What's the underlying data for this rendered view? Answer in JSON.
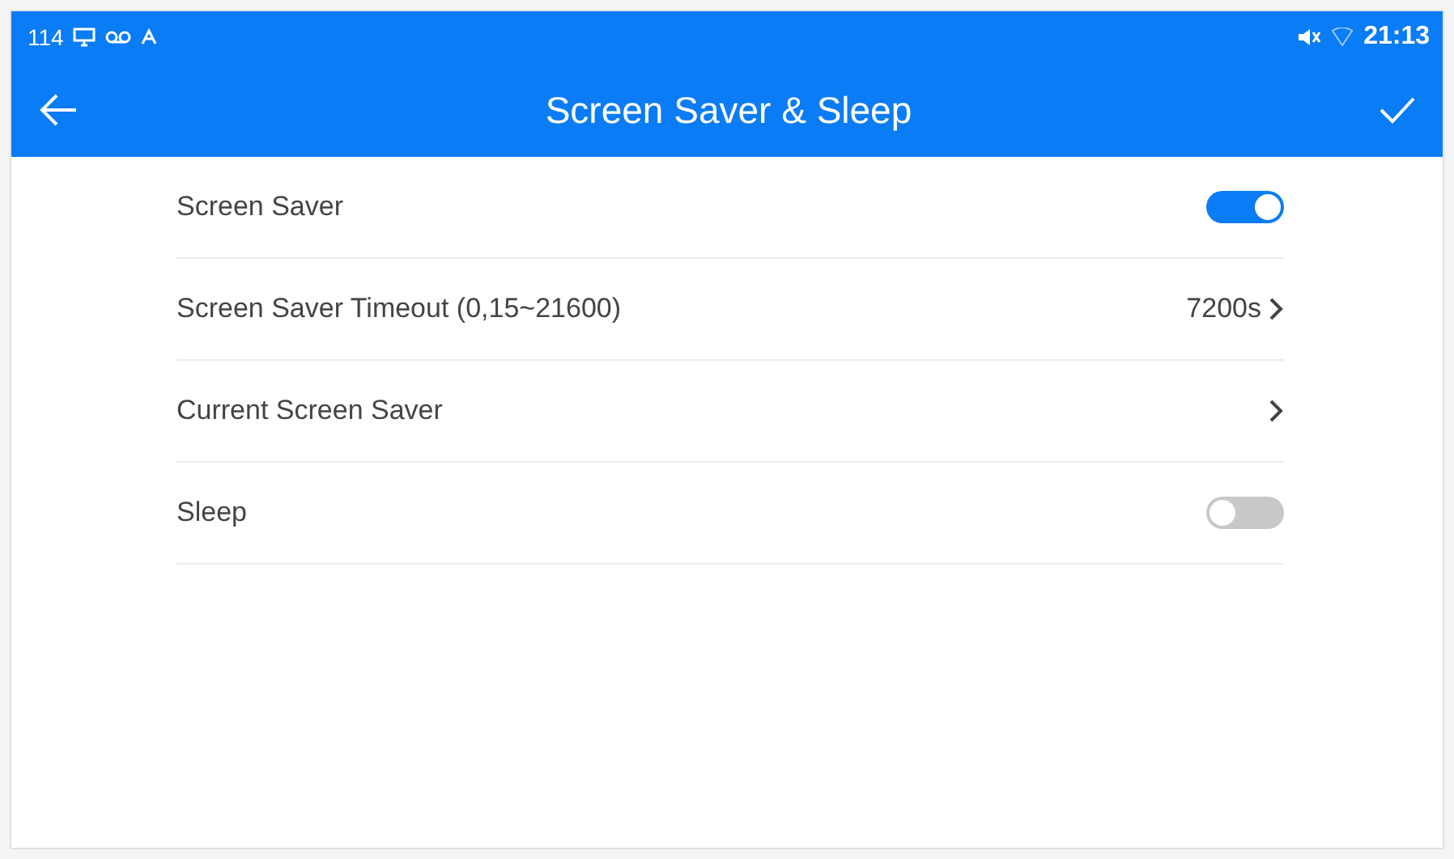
{
  "status_bar": {
    "left_text": "114",
    "time": "21:13"
  },
  "app_bar": {
    "title": "Screen Saver & Sleep"
  },
  "settings": [
    {
      "kind": "toggle",
      "label": "Screen Saver",
      "on": true
    },
    {
      "kind": "link",
      "label": "Screen Saver Timeout (0,15~21600)",
      "value": "7200s"
    },
    {
      "kind": "link",
      "label": "Current Screen Saver"
    },
    {
      "kind": "toggle",
      "label": "Sleep",
      "on": false
    }
  ]
}
